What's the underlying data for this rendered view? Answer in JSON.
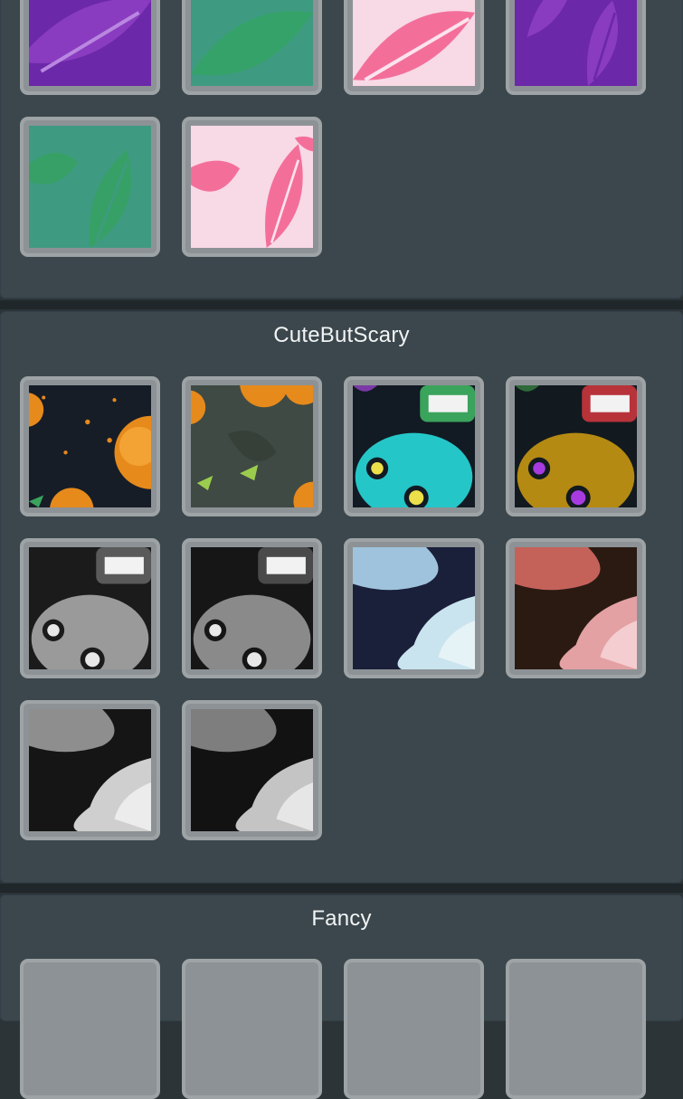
{
  "sections": [
    {
      "title": ""
    },
    {
      "title": "CuteButScary"
    },
    {
      "title": "Fancy"
    }
  ],
  "colors": {
    "purple": "#6d26a6",
    "teal": "#3f9a82",
    "pink": "#f6d6e4",
    "dark_navy": "#141c25",
    "pumpkin": "#e68a1c",
    "cyan_skull": "#25c6c8",
    "gold_skull": "#b58a12",
    "grey_skull": "#9a9a9a",
    "ghost_blue": "#9fc3dc",
    "ghost_pink": "#e3a1a3"
  }
}
